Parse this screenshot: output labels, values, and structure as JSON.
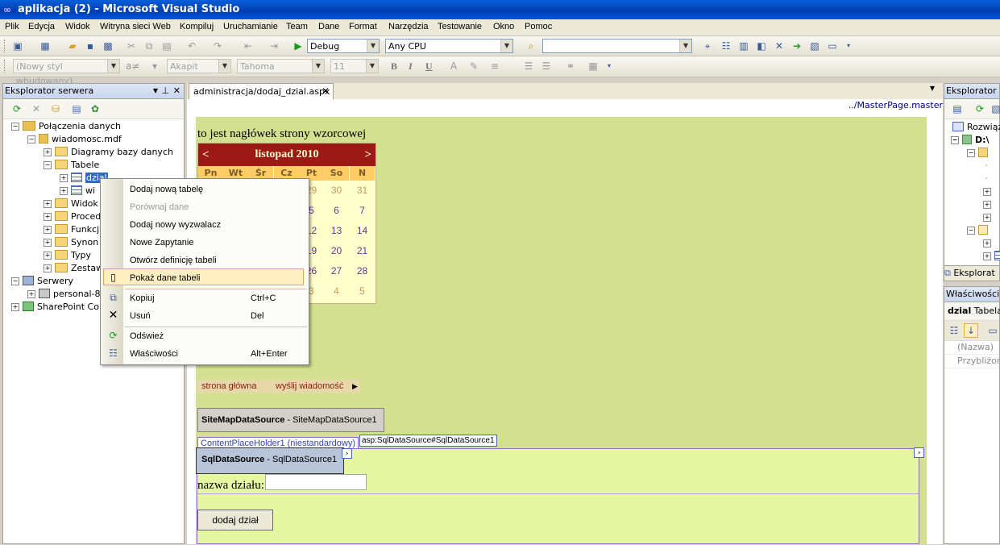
{
  "window": {
    "title": "aplikacja (2) - Microsoft Visual Studio"
  },
  "menu": [
    "Plik",
    "Edycja",
    "Widok",
    "Witryna sieci Web",
    "Kompiluj",
    "Uruchamianie",
    "Team",
    "Dane",
    "Format",
    "Narzędzia",
    "Testowanie",
    "Okno",
    "Pomoc"
  ],
  "toolbar1": {
    "config": "Debug",
    "platform": "Any CPU",
    "find": ""
  },
  "toolbar2": {
    "style": "(Nowy styl wbudowany)",
    "block": "Akapit",
    "font": "Tahoma",
    "size": "11",
    "bold": "B",
    "italic": "I",
    "underline": "U"
  },
  "server_explorer": {
    "title": "Eksplorator serwera",
    "nodes": {
      "connections": "Połączenia danych",
      "db": "wiadomosc.mdf",
      "diagrams": "Diagramy bazy danych",
      "tables": "Tabele",
      "t1": "dzial",
      "t2": "wi",
      "views": "Widok",
      "procs": "Proced",
      "funcs": "Funkcj",
      "syn": "Synon",
      "types": "Typy",
      "sets": "Zestaw",
      "servers": "Serwery",
      "personal": "personal-8",
      "sharepoint": "SharePoint Co"
    }
  },
  "editor": {
    "tab": "administracja/dodaj_dzial.aspx",
    "master": "../MasterPage.master",
    "header_text": "to jest nagłówek strony wzorcowej",
    "calendar": {
      "title": "listopad 2010",
      "prev": "<",
      "next": ">",
      "days": [
        "Pn",
        "Wt",
        "Śr",
        "Cz",
        "Pt",
        "So",
        "N"
      ],
      "visible_cells": [
        [
          "29",
          "30",
          "31"
        ],
        [
          "5",
          "6",
          "7"
        ],
        [
          "12",
          "13",
          "14"
        ],
        [
          "19",
          "20",
          "21"
        ],
        [
          "26",
          "27",
          "28"
        ],
        [
          "3",
          "4",
          "5"
        ]
      ]
    },
    "sitemap_links": [
      "strona główna",
      "wyślij wiadomość"
    ],
    "sitemap_ds": {
      "type": "SiteMapDataSource",
      "id": "SiteMapDataSource1"
    },
    "content_placeholder": "ContentPlaceHolder1 (niestandardowy)",
    "sql_tag": "asp:SqlDataSource#SqlDataSource1",
    "sql_ds": {
      "type": "SqlDataSource",
      "id": "SqlDataSource1"
    },
    "field_label": "nazwa działu:",
    "button": "dodaj dział"
  },
  "context_menu": {
    "items": [
      {
        "label": "Dodaj nową tabelę",
        "shortcut": ""
      },
      {
        "label": "Porównaj dane",
        "shortcut": "",
        "disabled": true
      },
      {
        "label": "Dodaj nowy wyzwalacz",
        "shortcut": ""
      },
      {
        "label": "Nowe Zapytanie",
        "shortcut": ""
      },
      {
        "label": "Otwórz definicję tabeli",
        "shortcut": ""
      },
      {
        "label": "Pokaż dane tabeli",
        "shortcut": ""
      },
      {
        "label": "Kopiuj",
        "shortcut": "Ctrl+C"
      },
      {
        "label": "Usuń",
        "shortcut": "Del"
      },
      {
        "label": "Odśwież",
        "shortcut": ""
      },
      {
        "label": "Właściwości",
        "shortcut": "Alt+Enter"
      }
    ]
  },
  "right_panels": {
    "solution_title": "Eksplorator ro",
    "sol_item1": "Rozwiąza",
    "sol_item2": "D:\\",
    "sol_bottom": "Eksplorat",
    "props_title": "Właściwości",
    "props_obj_name": "dzial",
    "props_obj_type": "Tabela",
    "prop1": "(Nazwa)",
    "prop2": "Przybliżona"
  }
}
